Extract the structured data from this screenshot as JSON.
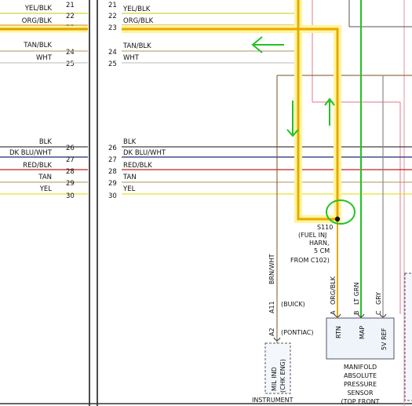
{
  "left_panel": {
    "rows": [
      {
        "pin": "21",
        "label": "YEL/BLK",
        "color": "#c8c800"
      },
      {
        "pin": "22",
        "label": "ORG/BLK",
        "color": "#d08a20"
      },
      {
        "pin": "23",
        "label": "",
        "color": "#e0b000"
      },
      {
        "pin": "24",
        "label": "TAN/BLK",
        "color": "#b09060"
      },
      {
        "pin": "25",
        "label": "WHT",
        "color": "#bbbbbb"
      },
      {
        "pin": "26",
        "label": "DK BLU/WHT",
        "color": "#1c2a7a"
      },
      {
        "pin": "27",
        "label": "RED/BLK",
        "color": "#c02020"
      },
      {
        "pin": "28",
        "label": "TAN",
        "color": "#b09060"
      },
      {
        "pin": "29",
        "label": "YEL",
        "color": "#e0d800"
      },
      {
        "pin": "30",
        "label": "",
        "color": "#e0d800"
      }
    ],
    "blk_label": "BLK"
  },
  "right_panel": {
    "rows": [
      {
        "pin": "21",
        "label": "YEL/BLK"
      },
      {
        "pin": "22",
        "label": "ORG/BLK"
      },
      {
        "pin": "23",
        "label": ""
      },
      {
        "pin": "24",
        "label": "TAN/BLK"
      },
      {
        "pin": "25",
        "label": "WHT"
      },
      {
        "pin": "26",
        "label": "DK BLU/WHT"
      },
      {
        "pin": "27",
        "label": "RED/BLK"
      },
      {
        "pin": "28",
        "label": "TAN"
      },
      {
        "pin": "29",
        "label": "YEL"
      },
      {
        "pin": "30",
        "label": ""
      }
    ],
    "blk_label": "BLK"
  },
  "splice": {
    "id": "S110",
    "desc": [
      "(FUEL INJ",
      "HARN,",
      "5 CM",
      "FROM C102)"
    ]
  },
  "wires": {
    "brn_wht": "BRN/WHT",
    "org_blk": "ORG/BLK",
    "lt_grn": "LT GRN",
    "gry": "GRY",
    "a11": "A11",
    "buick": "(BUICK)",
    "a2": "A2",
    "pontiac": "(PONTIAC)",
    "pin_a": "A",
    "pin_b": "B",
    "pin_c": "C"
  },
  "sensor": {
    "rtn": "RTN",
    "map": "MAP",
    "ref": "5V REF",
    "title": [
      "MANIFOLD",
      "ABSOLUTE",
      "PRESSURE",
      "SENSOR",
      "(TOP FRONT"
    ]
  },
  "instrument": {
    "label": "INSTRUMENT",
    "mil_lines": [
      "MIL IND",
      "(CHK ENG)"
    ]
  },
  "colors": {
    "highlight": "#ffe600",
    "highlight_glow": "#fff59a",
    "annotation": "#22c322",
    "pink": "#e890a0",
    "brown": "#7a5020"
  }
}
